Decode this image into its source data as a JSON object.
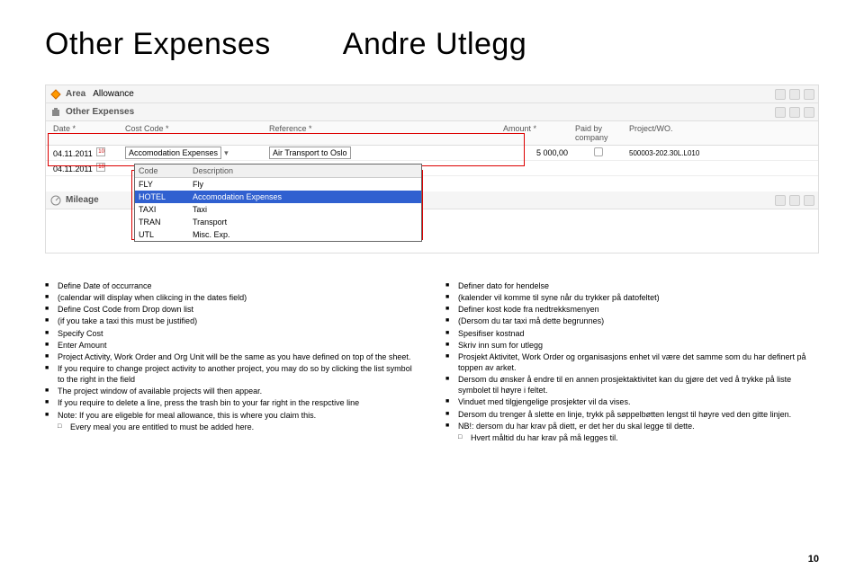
{
  "title_en": "Other Expenses",
  "title_no": "Andre Utlegg",
  "app": {
    "area_label": "Area",
    "area_value": "Allowance",
    "other_expenses_label": "Other Expenses",
    "mileage_label": "Mileage",
    "headers": {
      "date": "Date *",
      "cost_code": "Cost Code *",
      "reference": "Reference *",
      "amount": "Amount *",
      "paid_by": "Paid by company",
      "project": "Project/WO."
    },
    "row1": {
      "date": "04.11.2011",
      "cost_code": "Accomodation Expenses",
      "reference": "Air Transport to Oslo",
      "amount": "5 000,00",
      "project": "500003-202.30L.L010"
    },
    "row2": {
      "date": "04.11.2011"
    },
    "dropdown": {
      "code_h": "Code",
      "desc_h": "Description",
      "rows": [
        {
          "code": "FLY",
          "desc": "Fly"
        },
        {
          "code": "HOTEL",
          "desc": "Accomodation Expenses",
          "sel": true
        },
        {
          "code": "TAXI",
          "desc": "Taxi"
        },
        {
          "code": "TRAN",
          "desc": "Transport"
        },
        {
          "code": "UTL",
          "desc": "Misc. Exp."
        }
      ]
    }
  },
  "left_bullets": [
    "Define Date of occurrance",
    "(calendar will display when clikcing in the dates field)",
    "Define Cost Code from Drop down list",
    "(if you take a taxi this must be justified)",
    "Specify Cost",
    "Enter Amount",
    "Project Activity, Work Order and Org Unit will be the same as you have defined on top of the sheet.",
    "If you require to change project activity to another project, you may do so by clicking the list symbol to the right in the field",
    "The project window of available projects will then appear.",
    "If you require to delete a line, press the trash bin to your far right in the respctive line",
    "Note: If you are eligeble for meal allowance, this is where you claim this."
  ],
  "left_sub": "Every meal you are entitled to must be added here.",
  "right_bullets": [
    "Definer dato for hendelse",
    "(kalender vil komme til syne når du trykker på datofeltet)",
    "Definer kost kode fra nedtrekksmenyen",
    "(Dersom du tar taxi må dette begrunnes)",
    "Spesifiser kostnad",
    "Skriv inn sum for utlegg",
    "Prosjekt Aktivitet, Work Order og organisasjons enhet vil være det samme som du har definert på toppen av arket.",
    "Dersom du ønsker å endre til en annen prosjektaktivitet kan du gjøre det ved å trykke på liste symbolet til høyre i feltet.",
    "Vinduet med tilgjengelige prosjekter vil da vises.",
    "Dersom du trenger å slette en linje, trykk på søppelbøtten lengst til høyre ved den gitte linjen.",
    "NB!: dersom du har krav på diett, er det her du skal legge til dette."
  ],
  "right_sub": "Hvert måltid du har krav på må legges til.",
  "page_num": "10"
}
